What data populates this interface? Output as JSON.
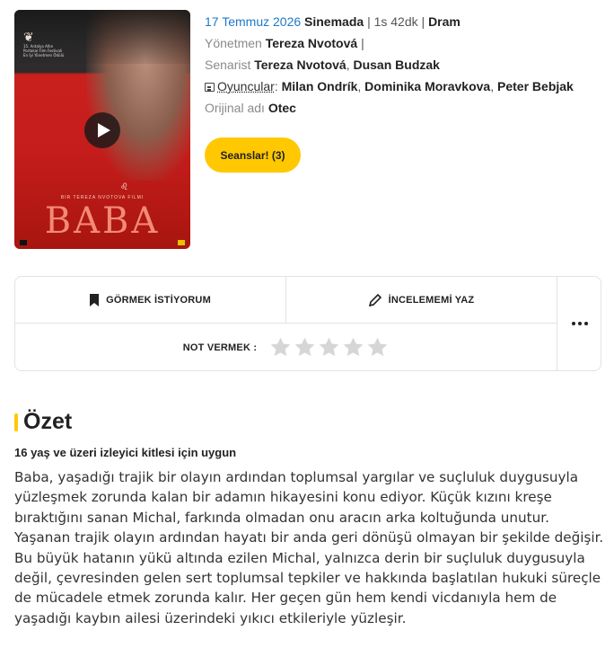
{
  "poster": {
    "title": "BABA",
    "credit": "BIR TEREZA NVOTOVA FILMI",
    "festival": "15. Antalya Altın Portakal Film Festivali En İyi Yönetmen Ödülü"
  },
  "meta": {
    "date": "17 Temmuz 2026",
    "status": "Sinemada",
    "duration": "1s 42dk",
    "genre": "Dram",
    "sep": "|",
    "director_label": "Yönetmen",
    "director": "Tereza Nvotová",
    "writer_label": "Senarist",
    "writers": [
      "Tereza Nvotová",
      "Dusan Budzak"
    ],
    "cast_label": "Oyuncular",
    "cast": [
      "Milan Ondrík",
      "Dominika Moravkova",
      "Peter Bebjak"
    ],
    "original_title_label": "Orijinal adı",
    "original_title": "Otec"
  },
  "sessions_button": "Seanslar! (3)",
  "actions": {
    "watchlist": "GÖRMEK İSTİYORUM",
    "review": "İNCELEMEMİ YAZ",
    "rate_label": "NOT VERMEK :",
    "stars_total": 5,
    "stars_filled": 0
  },
  "summary": {
    "title": "Özet",
    "age_note": "16 yaş ve üzeri izleyici kitlesi için uygun",
    "text": "Baba, yaşadığı trajik bir olayın ardından toplumsal yargılar ve suçluluk duygusuyla yüzleşmek zorunda kalan bir adamın hikayesini konu ediyor. Küçük kızını kreşe bıraktığını sanan Michal, farkında olmadan onu aracın arka koltuğunda unutur. Yaşanan trajik olayın ardından hayatı bir anda geri dönüşü olmayan bir şekilde değişir. Bu büyük hatanın yükü altında ezilen Michal, yalnızca derin bir suçluluk duygusuyla değil, çevresinden gelen sert toplumsal tepkiler ve hakkında başlatılan hukuki süreçle de mücadele etmek zorunda kalır. Her geçen gün hem kendi vicdanıyla hem de yaşadığı kaybın ailesi üzerindeki yıkıcı etkileriyle yüzleşir."
  },
  "colors": {
    "accent": "#ffc800",
    "link": "#1e78c8",
    "poster_red": "#c41d1b"
  },
  "icons": [
    "play-icon",
    "bookmark-icon",
    "pencil-icon",
    "more-dots-icon",
    "star-icon",
    "cast-list-icon"
  ]
}
